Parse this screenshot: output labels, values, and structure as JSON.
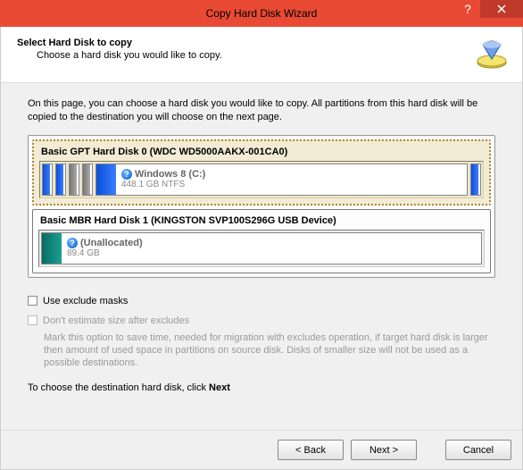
{
  "window": {
    "title": "Copy Hard Disk Wizard"
  },
  "header": {
    "title": "Select Hard Disk to copy",
    "subtitle": "Choose a hard disk you would like to copy."
  },
  "description": "On this page, you can choose a hard disk you would like to copy. All partitions from this hard disk will be copied to the destination you will choose on the next page.",
  "disks": [
    {
      "title": "Basic GPT Hard Disk 0 (WDC WD5000AAKX-001CA0)",
      "selected": true,
      "partitions": {
        "main_label": "Windows 8 (C:)",
        "main_info": "448.1 GB NTFS"
      }
    },
    {
      "title": "Basic MBR Hard Disk 1 (KINGSTON  SVP100S296G USB Device)",
      "selected": false,
      "partitions": {
        "main_label": "(Unallocated)",
        "main_info": "89.4 GB"
      }
    }
  ],
  "options": {
    "exclude_label": "Use exclude masks",
    "estimate_label": "Don't estimate size after excludes",
    "estimate_hint": "Mark this option to save time, needed for migration with excludes operation, if target hard disk is larger then amount of used space in partitions on source disk. Disks of smaller size will not be used as a possible destinations."
  },
  "footer_note_prefix": "To choose the destination hard disk, click ",
  "footer_note_bold": "Next",
  "buttons": {
    "back": "< Back",
    "next": "Next >",
    "cancel": "Cancel"
  }
}
